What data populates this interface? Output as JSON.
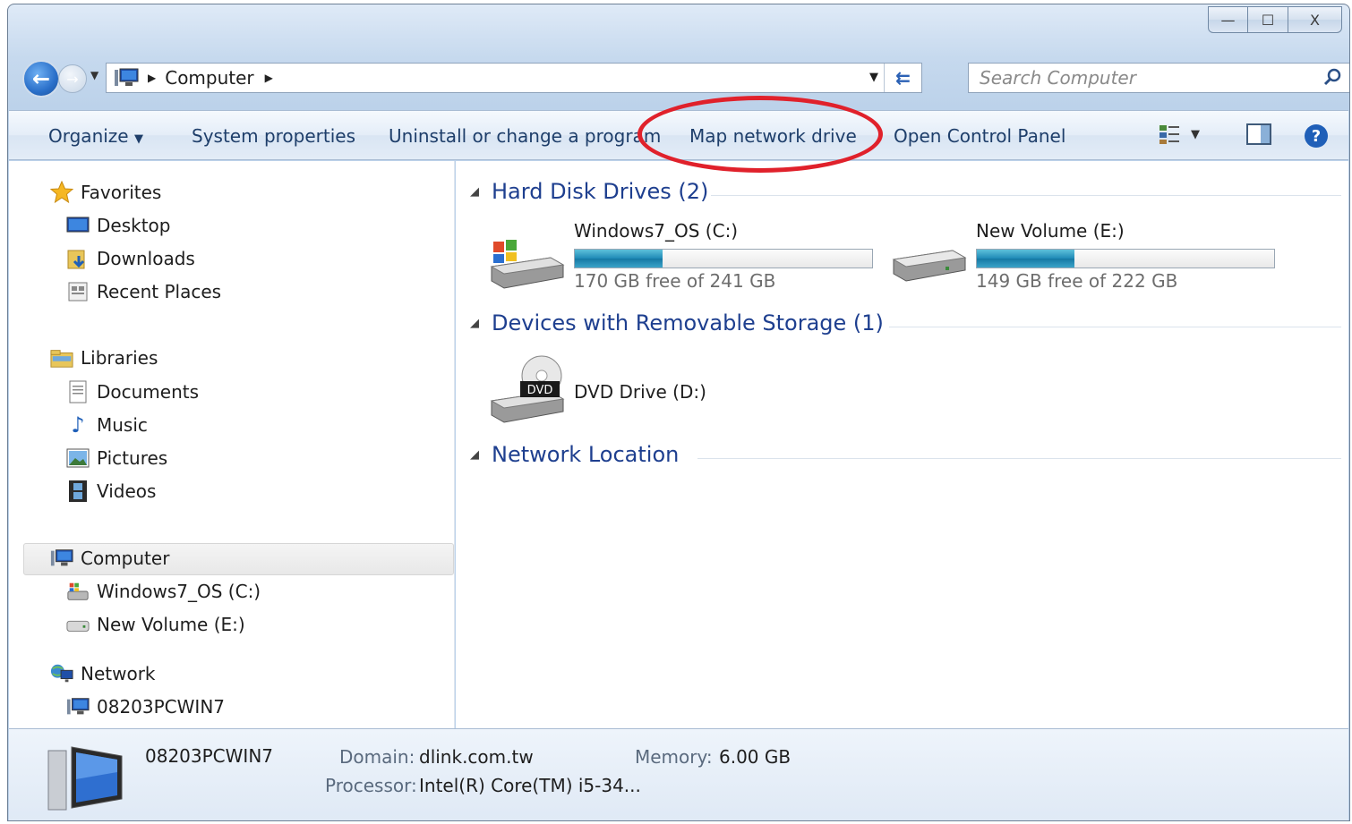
{
  "window": {
    "caption": {
      "minimize": "—",
      "maximize": "☐",
      "close": "X"
    }
  },
  "address_bar": {
    "path_label": "Computer",
    "search_placeholder": "Search Computer"
  },
  "command_bar": {
    "organize": "Organize",
    "system_properties": "System properties",
    "uninstall": "Uninstall or change a program",
    "map_network_drive": "Map network drive",
    "open_control_panel": "Open Control Panel"
  },
  "nav_pane": {
    "favorites": "Favorites",
    "desktop": "Desktop",
    "downloads": "Downloads",
    "recent_places": "Recent Places",
    "libraries": "Libraries",
    "documents": "Documents",
    "music": "Music",
    "pictures": "Pictures",
    "videos": "Videos",
    "computer": "Computer",
    "drive_c": "Windows7_OS (C:)",
    "drive_e": "New Volume (E:)",
    "network": "Network",
    "network_pc": "08203PCWIN7"
  },
  "content": {
    "groups": {
      "hard_disk": "Hard Disk Drives (2)",
      "removable": "Devices with Removable Storage (1)",
      "network": "Network Location"
    },
    "drives": [
      {
        "name": "Windows7_OS (C:)",
        "free_text": "170 GB free of 241 GB",
        "used_fraction": 0.295
      },
      {
        "name": "New Volume (E:)",
        "free_text": "149 GB free of 222 GB",
        "used_fraction": 0.329
      }
    ],
    "dvd": {
      "name": "DVD Drive (D:)",
      "badge": "DVD"
    }
  },
  "details": {
    "computer_name": "08203PCWIN7",
    "domain_label": "Domain:",
    "domain_value": "dlink.com.tw",
    "memory_label": "Memory:",
    "memory_value": "6.00 GB",
    "processor_label": "Processor:",
    "processor_value": "Intel(R) Core(TM) i5-34..."
  },
  "colors": {
    "annotation_ring": "#e0212b",
    "bar_fill": "#1e89b6",
    "link_blue": "#1e3f8f"
  }
}
